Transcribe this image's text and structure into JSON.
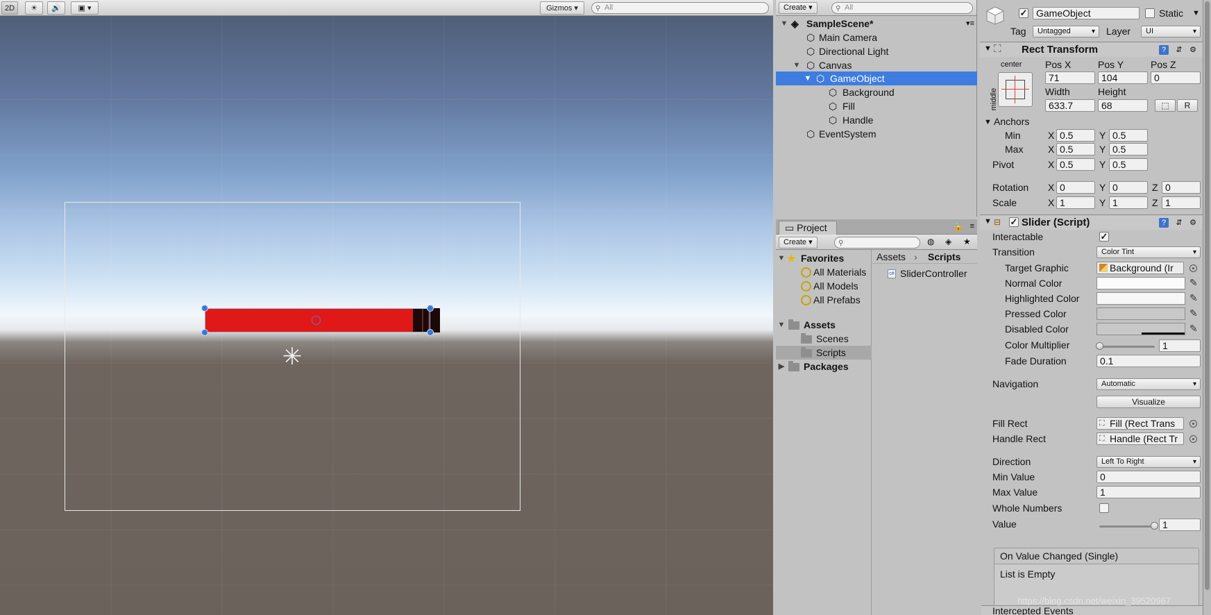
{
  "scene_toolbar": {
    "mode_2d": "2D",
    "gizmos_label": "Gizmos",
    "search_placeholder": "All"
  },
  "hierarchy": {
    "create_label": "Create",
    "search_placeholder": "All",
    "scene_name": "SampleScene*",
    "items": [
      {
        "label": "Main Camera"
      },
      {
        "label": "Directional Light"
      },
      {
        "label": "Canvas"
      },
      {
        "label": "GameObject"
      },
      {
        "label": "Background"
      },
      {
        "label": "Fill"
      },
      {
        "label": "Handle"
      },
      {
        "label": "EventSystem"
      }
    ]
  },
  "project": {
    "tab_label": "Project",
    "create_label": "Create",
    "favorites_label": "Favorites",
    "favorites": [
      "All Materials",
      "All Models",
      "All Prefabs"
    ],
    "assets_label": "Assets",
    "asset_folders": [
      "Scenes",
      "Scripts"
    ],
    "packages_label": "Packages",
    "breadcrumb_root": "Assets",
    "breadcrumb_current": "Scripts",
    "files": [
      "SliderController"
    ]
  },
  "inspector": {
    "object_name": "GameObject",
    "static_label": "Static",
    "tag_label": "Tag",
    "tag_value": "Untagged",
    "layer_label": "Layer",
    "layer_value": "UI",
    "rect_transform": {
      "title": "Rect Transform",
      "anchor_h": "center",
      "anchor_v": "middle",
      "pos_x_label": "Pos X",
      "pos_y_label": "Pos Y",
      "pos_z_label": "Pos Z",
      "pos_x": "71",
      "pos_y": "104",
      "pos_z": "0",
      "width_label": "Width",
      "height_label": "Height",
      "width": "633.7",
      "height": "68",
      "r_button": "R",
      "anchors_label": "Anchors",
      "min_label": "Min",
      "max_label": "Max",
      "pivot_label": "Pivot",
      "x_label": "X",
      "y_label": "Y",
      "z_label": "Z",
      "min_x": "0.5",
      "min_y": "0.5",
      "max_x": "0.5",
      "max_y": "0.5",
      "pivot_x": "0.5",
      "pivot_y": "0.5",
      "rotation_label": "Rotation",
      "rot_x": "0",
      "rot_y": "0",
      "rot_z": "0",
      "scale_label": "Scale",
      "scale_x": "1",
      "scale_y": "1",
      "scale_z": "1"
    },
    "slider": {
      "title": "Slider (Script)",
      "interactable_label": "Interactable",
      "transition_label": "Transition",
      "transition_value": "Color Tint",
      "target_graphic_label": "Target Graphic",
      "target_graphic_value": "Background (Ir",
      "normal_color_label": "Normal Color",
      "highlighted_color_label": "Highlighted Color",
      "pressed_color_label": "Pressed Color",
      "disabled_color_label": "Disabled Color",
      "color_multiplier_label": "Color Multiplier",
      "color_multiplier_value": "1",
      "color_multiplier_fraction": 0.0,
      "fade_duration_label": "Fade Duration",
      "fade_duration_value": "0.1",
      "navigation_label": "Navigation",
      "navigation_value": "Automatic",
      "visualize_label": "Visualize",
      "fill_rect_label": "Fill Rect",
      "fill_rect_value": "Fill (Rect Trans",
      "handle_rect_label": "Handle Rect",
      "handle_rect_value": "Handle (Rect Tr",
      "direction_label": "Direction",
      "direction_value": "Left To Right",
      "min_value_label": "Min Value",
      "min_value": "0",
      "max_value_label": "Max Value",
      "max_value": "1",
      "whole_numbers_label": "Whole Numbers",
      "value_label": "Value",
      "value": "1",
      "value_fraction": 1.0,
      "on_value_changed_label": "On Value Changed (Single)",
      "list_empty_label": "List is Empty",
      "intercepted_events_label": "Intercepted Events"
    },
    "colors": {
      "normal": "#fbfbfb",
      "highlighted": "#f7f7f7",
      "pressed": "#c8c8c8",
      "disabled": "#c8c8c8"
    }
  },
  "watermark": "https://blog.csdn.net/weixin_39520967",
  "colors": {
    "selection": "#3e7ce0",
    "slider_fill": "#e01818",
    "slider_handle": "#1d0808"
  }
}
